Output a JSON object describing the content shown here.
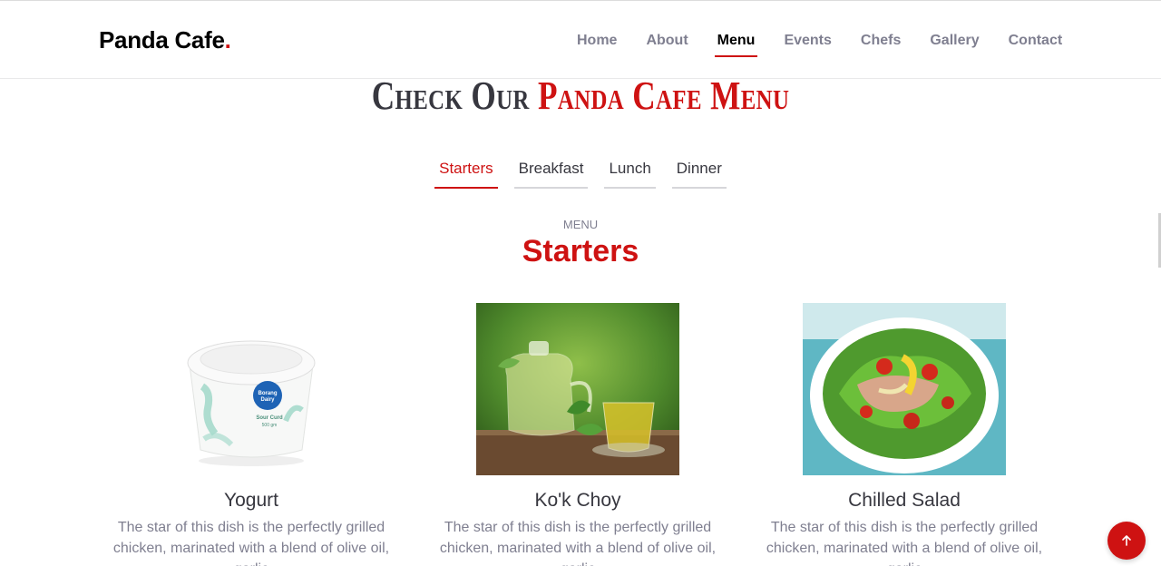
{
  "brand": {
    "name": "Panda Cafe",
    "dot": "."
  },
  "nav": {
    "items": [
      {
        "label": "Home",
        "active": false
      },
      {
        "label": "About",
        "active": false
      },
      {
        "label": "Menu",
        "active": true
      },
      {
        "label": "Events",
        "active": false
      },
      {
        "label": "Chefs",
        "active": false
      },
      {
        "label": "Gallery",
        "active": false
      },
      {
        "label": "Contact",
        "active": false
      }
    ]
  },
  "section": {
    "title_prefix": "Check Our",
    "title_accent": "Panda Cafe Menu"
  },
  "tabs": [
    {
      "label": "Starters",
      "active": true
    },
    {
      "label": "Breakfast",
      "active": false
    },
    {
      "label": "Lunch",
      "active": false
    },
    {
      "label": "Dinner",
      "active": false
    }
  ],
  "menu": {
    "subtitle": "Menu",
    "heading": "Starters",
    "items": [
      {
        "name": "Yogurt",
        "description": "The star of this dish is the perfectly grilled chicken, marinated with a blend of olive oil, garlic"
      },
      {
        "name": "Ko'k Choy",
        "description": "The star of this dish is the perfectly grilled chicken, marinated with a blend of olive oil, garlic"
      },
      {
        "name": "Chilled Salad",
        "description": "The star of this dish is the perfectly grilled chicken, marinated with a blend of olive oil, garlic"
      }
    ]
  },
  "yogurt_label": {
    "line1": "Borang",
    "line2": "Dairy",
    "line3": "Sour Curd",
    "line4": "500 gm"
  },
  "scroll_top": {
    "icon": "arrow-up-icon"
  },
  "colors": {
    "accent": "#ce1212",
    "text": "#37373f",
    "muted": "#7f7f90"
  }
}
